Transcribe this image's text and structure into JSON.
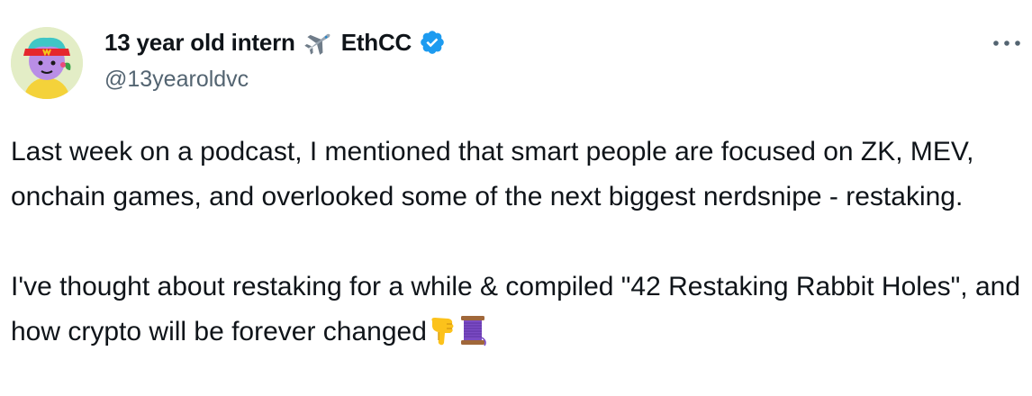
{
  "tweet": {
    "author": {
      "display_name": "13 year old intern",
      "display_name_suffix": "EthCC",
      "handle": "@13yearoldvc",
      "verified": true,
      "avatar_icon": "cartoon-avatar-red-visor",
      "name_emoji_icon": "airplane-icon",
      "verified_color": "#1d9bf0"
    },
    "more_icon": "more-options-icon",
    "paragraphs": [
      "Last week on a podcast, I mentioned that smart people are focused on ZK, MEV, onchain games, and overlooked some of the next biggest nerdsnipe - restaking.",
      "I've thought about restaking for a while & compiled \"42 Restaking Rabbit Holes\", and how crypto will be forever changed"
    ],
    "trailing_emojis": [
      "pointing-down-icon",
      "thread-spool-icon"
    ]
  },
  "colors": {
    "text": "#0f1419",
    "secondary_text": "#536471",
    "accent": "#1d9bf0"
  }
}
